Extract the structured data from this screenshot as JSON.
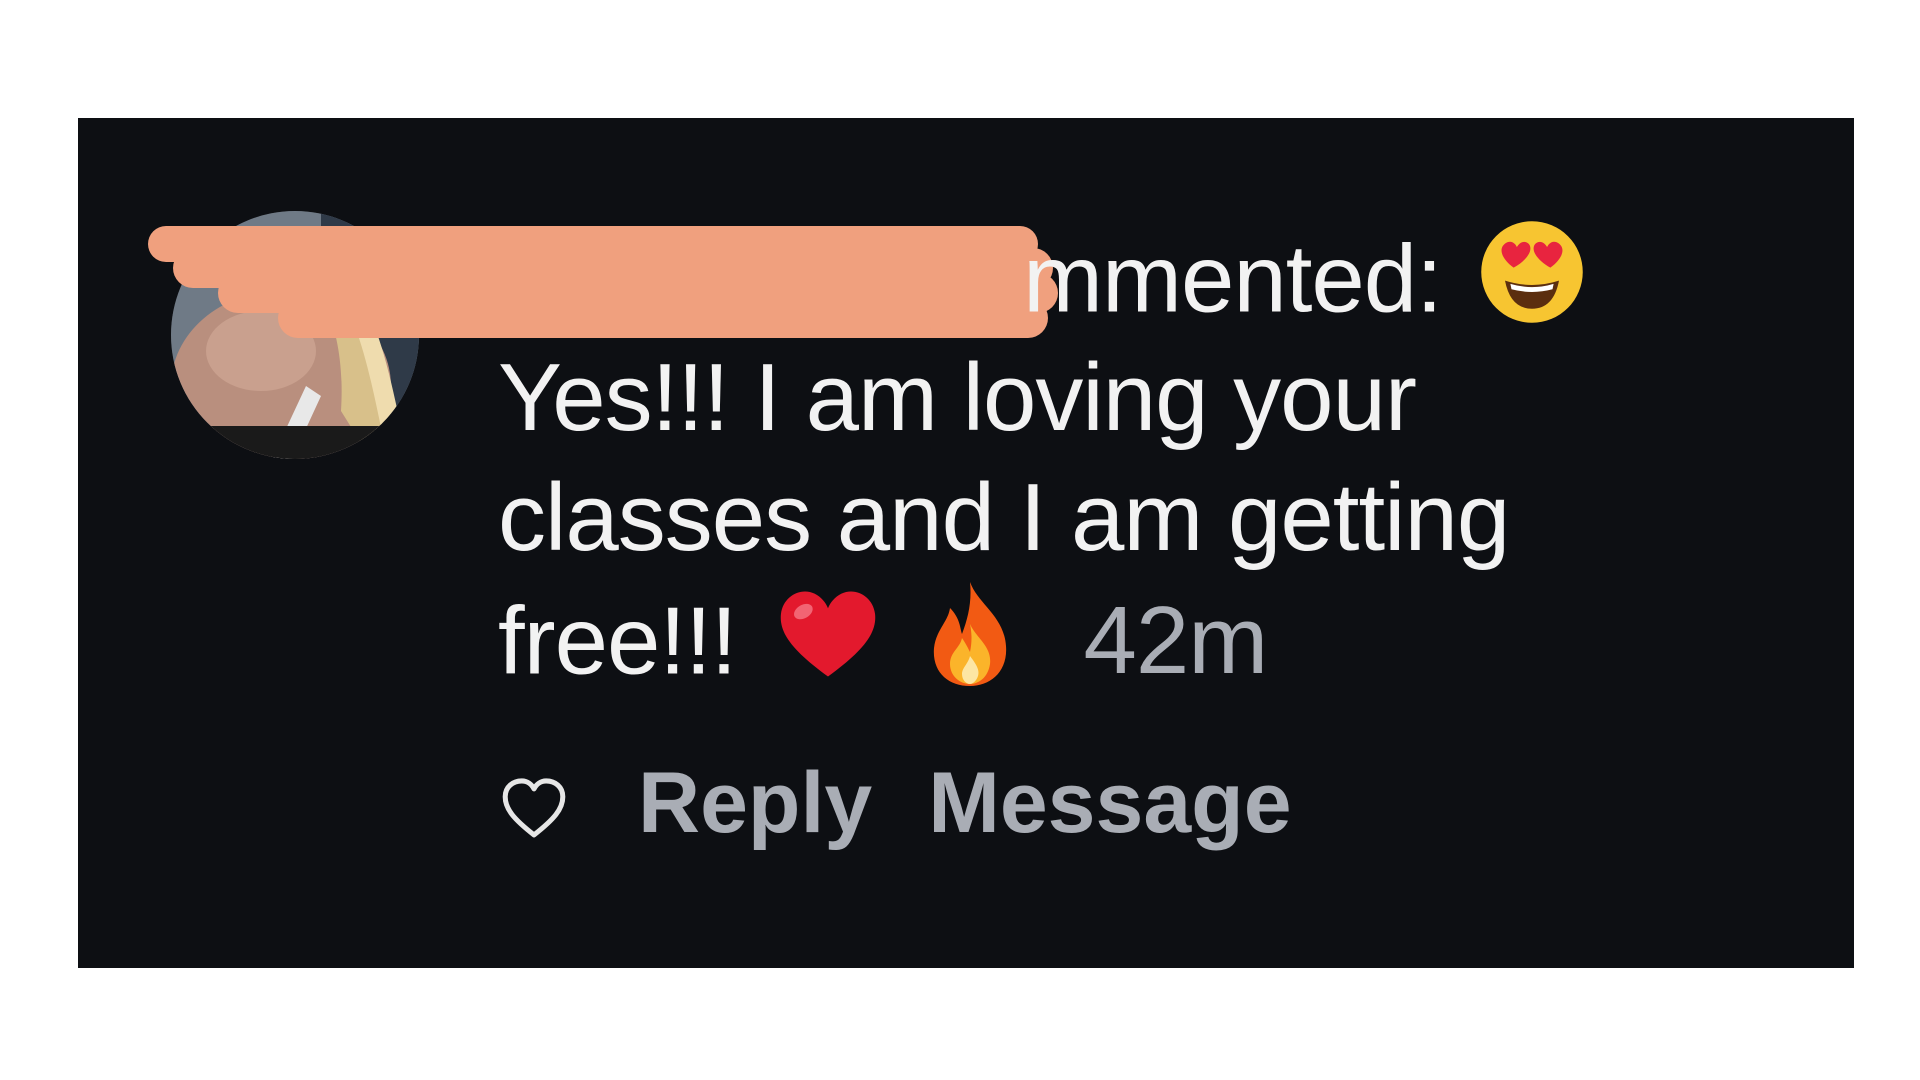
{
  "comment": {
    "header_visible_text": "mmented:",
    "line2": "Yes!!! I am loving your",
    "line3": "classes and I am getting",
    "line4": "free!!!",
    "timestamp": "42m",
    "emojis": [
      "heart-eyes-emoji",
      "red-heart-emoji",
      "fire-emoji"
    ]
  },
  "actions": {
    "like_icon": "heart-outline-icon",
    "reply_label": "Reply",
    "message_label": "Message"
  },
  "colors": {
    "panel_bg": "#0d0f13",
    "text": "#f2f2f2",
    "muted": "#a9adb5",
    "redaction": "#f0a07e"
  }
}
